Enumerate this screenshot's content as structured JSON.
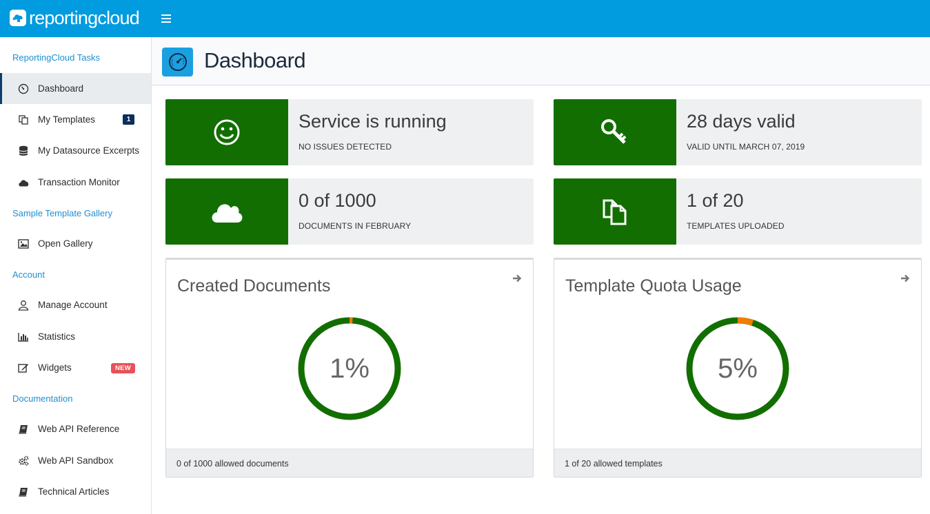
{
  "brand": {
    "name": "reportingcloud"
  },
  "sidebar": {
    "sections": [
      {
        "title": "ReportingCloud Tasks"
      },
      {
        "title": "Sample Template Gallery"
      },
      {
        "title": "Account"
      },
      {
        "title": "Documentation"
      }
    ],
    "items": [
      {
        "label": "Dashboard",
        "icon": "speedometer-icon"
      },
      {
        "label": "My Templates",
        "icon": "copy-icon",
        "badge": "1"
      },
      {
        "label": "My Datasource Excerpts",
        "icon": "database-icon"
      },
      {
        "label": "Transaction Monitor",
        "icon": "cloud-icon"
      },
      {
        "label": "Open Gallery",
        "icon": "image-icon"
      },
      {
        "label": "Manage Account",
        "icon": "user-icon"
      },
      {
        "label": "Statistics",
        "icon": "bar-chart-icon"
      },
      {
        "label": "Widgets",
        "icon": "edit-icon",
        "badge": "NEW"
      },
      {
        "label": "Web API Reference",
        "icon": "book-icon"
      },
      {
        "label": "Web API Sandbox",
        "icon": "gears-icon"
      },
      {
        "label": "Technical Articles",
        "icon": "book-icon"
      }
    ]
  },
  "header": {
    "title": "Dashboard"
  },
  "tiles": [
    {
      "value": "Service is running",
      "sub": "NO ISSUES DETECTED",
      "icon": "smiley-icon"
    },
    {
      "value": "28 days valid",
      "sub": "VALID UNTIL MARCH 07, 2019",
      "icon": "key-icon"
    },
    {
      "value": "0 of 1000",
      "sub": "DOCUMENTS IN FEBRUARY",
      "icon": "cloud-icon"
    },
    {
      "value": "1 of 20",
      "sub": "TEMPLATES UPLOADED",
      "icon": "files-icon"
    }
  ],
  "cards": [
    {
      "title": "Created Documents",
      "percent_label": "1%",
      "fraction": 0.01,
      "footer": "0 of 1000 allowed documents"
    },
    {
      "title": "Template Quota Usage",
      "percent_label": "5%",
      "fraction": 0.05,
      "footer": "1 of 20 allowed templates"
    }
  ],
  "colors": {
    "topbar": "#019bdf",
    "tile_green": "#126e00",
    "donut_track": "#126e00",
    "donut_fill": "#f07d00",
    "section_title": "#1f8ed0",
    "badge_dark": "#0d2d5c",
    "badge_new": "#e9515a"
  }
}
